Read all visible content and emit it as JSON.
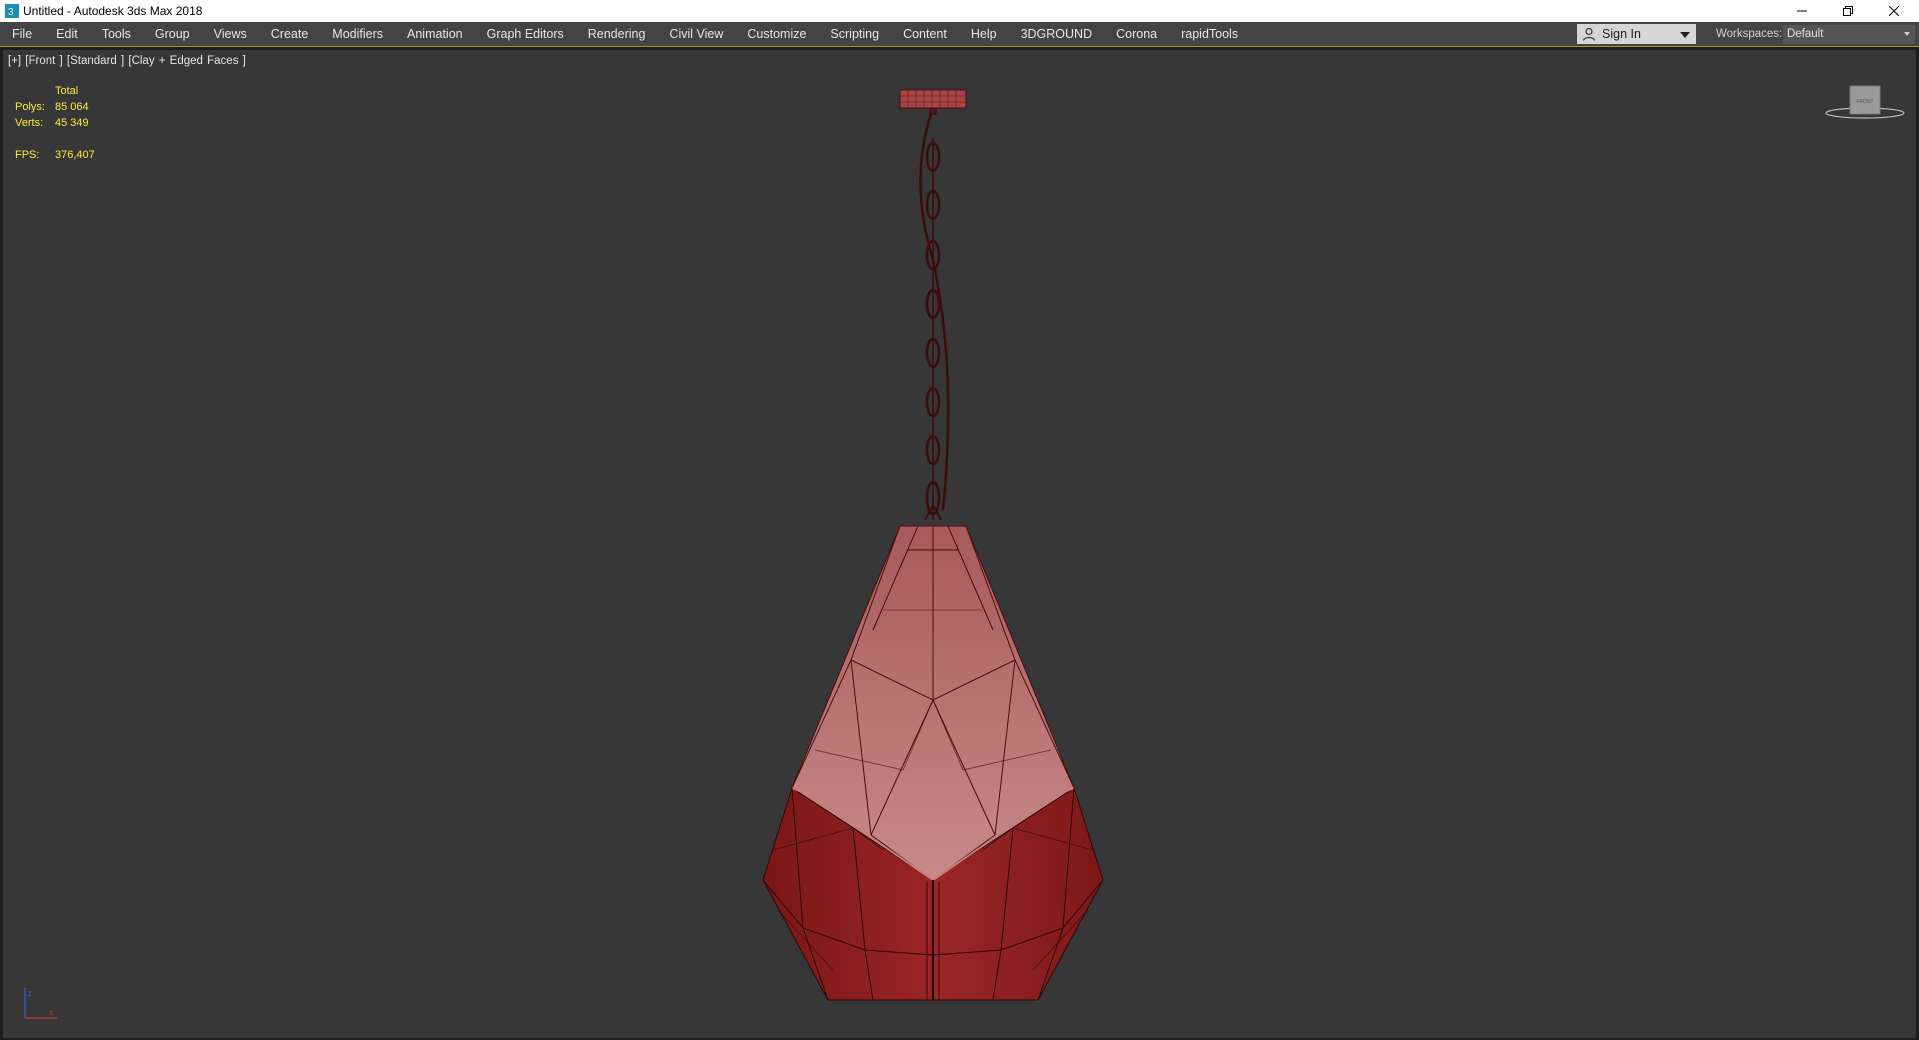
{
  "window": {
    "title": "Untitled - Autodesk 3ds Max 2018",
    "app_icon": "3ds-max-icon",
    "controls": [
      "minimize-icon",
      "restore-icon",
      "close-icon"
    ]
  },
  "menubar": {
    "items": [
      "File",
      "Edit",
      "Tools",
      "Group",
      "Views",
      "Create",
      "Modifiers",
      "Animation",
      "Graph Editors",
      "Rendering",
      "Civil View",
      "Customize",
      "Scripting",
      "Content",
      "Help",
      "3DGROUND",
      "Corona",
      "rapidTools"
    ],
    "signin_label": "Sign In",
    "workspaces_label": "Workspaces:",
    "workspaces_value": "Default"
  },
  "viewport": {
    "label": "[+] [Front ] [Standard ] [Clay + Edged Faces ]",
    "stats": {
      "header": "Total",
      "polys_label": "Polys:",
      "polys_value": "85 064",
      "verts_label": "Verts:",
      "verts_value": "45 349",
      "fps_label": "FPS:",
      "fps_value": "376,407"
    },
    "viewcube_face": "FRONT",
    "background_color": "#373737",
    "model_color": "#8b1c1c",
    "stats_color": "#ffeb3b"
  },
  "accent_color": "#b28c1e"
}
